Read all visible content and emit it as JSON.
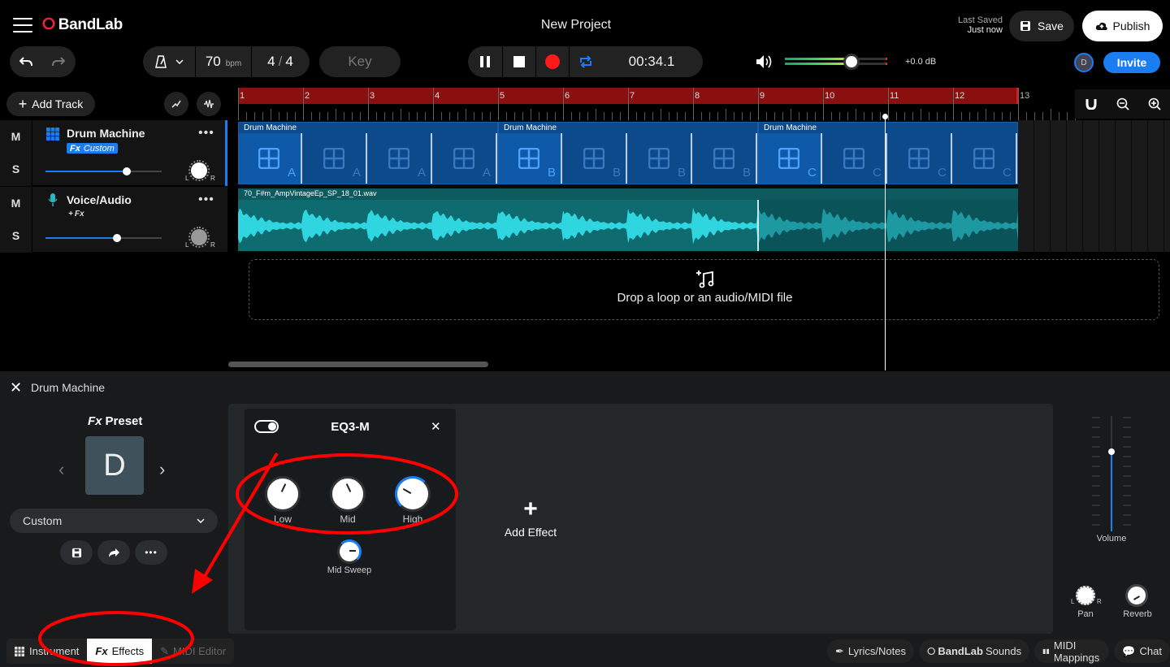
{
  "app": {
    "logo": "BandLab",
    "project_title": "New Project"
  },
  "header": {
    "last_saved_label": "Last Saved",
    "last_saved_value": "Just now",
    "save_label": "Save",
    "publish_label": "Publish",
    "invite_label": "Invite",
    "avatar_initial": "D"
  },
  "transport": {
    "tempo": "70",
    "tempo_unit": "bpm",
    "time_sig_num": "4",
    "time_sig_den": "4",
    "key_label": "Key",
    "time": "00:34.1",
    "volume_db": "+0.0 dB",
    "volume_level": 0.65
  },
  "tracks": {
    "add_track_label": "Add Track",
    "items": [
      {
        "name": "Drum Machine",
        "fx_badge": "Custom",
        "fx_prefix": "Fx",
        "m": "M",
        "s": "S",
        "knob_l": "L",
        "knob_r": "R"
      },
      {
        "name": "Voice/Audio",
        "fx_badge": "Fx",
        "fx_prefix": "+",
        "m": "M",
        "s": "S",
        "knob_l": "L",
        "knob_r": "R"
      }
    ]
  },
  "ruler": {
    "bars": [
      "1",
      "2",
      "3",
      "4",
      "5",
      "6",
      "7",
      "8",
      "9",
      "10",
      "11",
      "12",
      "13"
    ]
  },
  "clips": {
    "drum_label": "Drum Machine",
    "patterns": [
      "A",
      "A",
      "A",
      "A",
      "B",
      "B",
      "B",
      "B",
      "C",
      "C",
      "C",
      "C"
    ],
    "audio_label": "70_F#m_AmpVintageEp_SP_18_01.wav"
  },
  "drop_zone": {
    "text": "Drop a loop or an audio/MIDI file"
  },
  "panel": {
    "title": "Drum Machine",
    "preset_heading_fx": "Fx",
    "preset_heading": "Preset",
    "preset_letter": "D",
    "preset_select": "Custom",
    "effect": {
      "name": "EQ3-M",
      "knobs": [
        {
          "label": "Low"
        },
        {
          "label": "Mid"
        },
        {
          "label": "High"
        }
      ],
      "extra_knob": "Mid Sweep"
    },
    "add_effect_label": "Add Effect",
    "volume_label": "Volume",
    "pan_label": "Pan",
    "pan_l": "L",
    "pan_r": "R",
    "reverb_label": "Reverb"
  },
  "bottom_tabs": {
    "instrument": "Instrument",
    "effects_fx": "Fx",
    "effects": "Effects",
    "midi_editor": "MIDI Editor",
    "lyrics": "Lyrics/Notes",
    "sounds_brand": "BandLab",
    "sounds": "Sounds",
    "midi_mappings": "MIDI Mappings",
    "chat": "Chat"
  },
  "colors": {
    "accent": "#1b7df2",
    "record": "#ff1a1a",
    "ruler": "#8a1010",
    "annotation": "#ff0000"
  }
}
